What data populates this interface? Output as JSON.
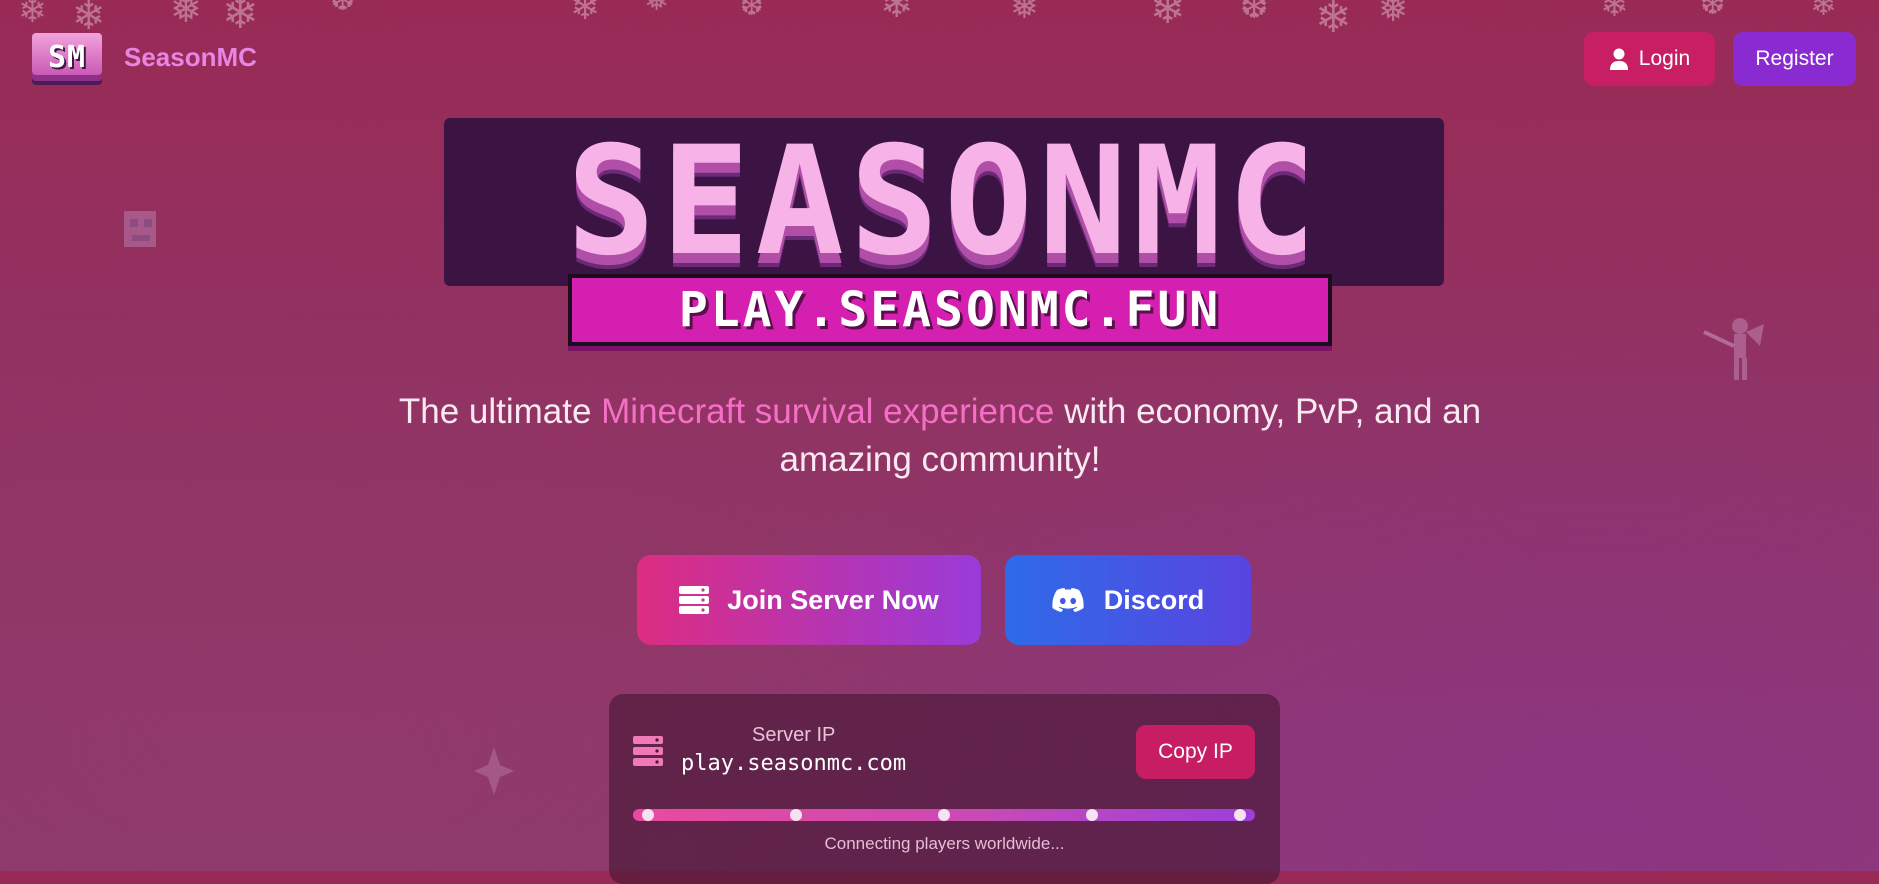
{
  "nav": {
    "brand_logo": "SM",
    "brand_name": "SeasonMC",
    "login_label": "Login",
    "register_label": "Register"
  },
  "hero": {
    "logo_title": "SEASONMC",
    "logo_subtitle": "PLAY.SEASONMC.FUN",
    "tagline_before": "The ultimate ",
    "tagline_highlight": "Minecraft survival experience",
    "tagline_after": " with economy, PvP, and an amazing community!"
  },
  "actions": {
    "join_label": "Join Server Now",
    "discord_label": "Discord"
  },
  "server": {
    "label": "Server IP",
    "ip": "play.seasonmc.com",
    "copy_label": "Copy IP",
    "status_text": "Connecting players worldwide...",
    "progress_markers": 5
  },
  "colors": {
    "accent_pink": "#c81e63",
    "accent_purple": "#8a2bd1",
    "highlight": "#f56fc6",
    "discord_blue": "#2e6be8"
  },
  "icons": {
    "login": "user-icon",
    "join": "server-icon",
    "discord": "discord-icon",
    "server": "server-icon",
    "decor": "snowflake-icon"
  }
}
